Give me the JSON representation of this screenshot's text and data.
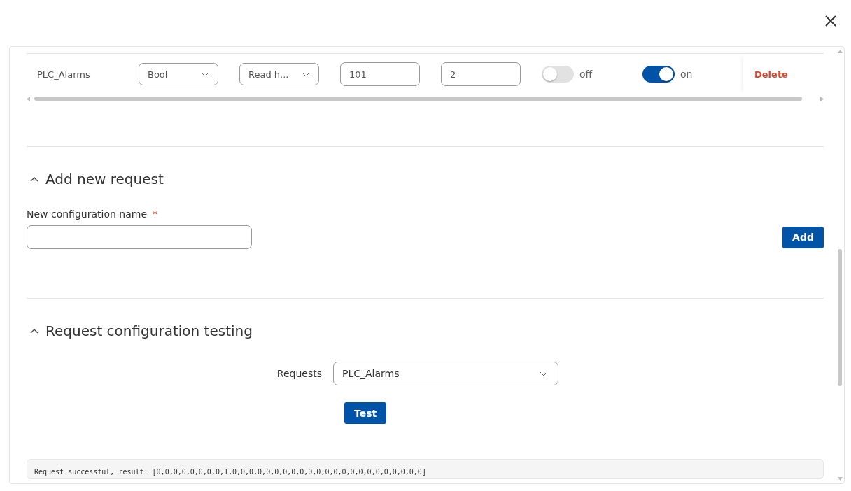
{
  "table": {
    "rows": [
      {
        "name": "PLC_Alarms",
        "type": "Bool",
        "function": "Read h...",
        "start": "101",
        "count": "2",
        "switches": [
          {
            "on": false,
            "label": "off"
          },
          {
            "on": true,
            "label": "on"
          }
        ],
        "delete": "Delete"
      }
    ]
  },
  "add_section": {
    "title": "Add new request",
    "expanded": true,
    "field_label": "New configuration name",
    "required_mark": "*",
    "button": "Add"
  },
  "test_section": {
    "title": "Request configuration testing",
    "expanded": true,
    "requests_label": "Requests",
    "requests_value": "PLC_Alarms",
    "button": "Test",
    "result": "Request successful, result: [0,0,0,0,0,0,0,0,1,0,0,0,0,0,0,0,0,0,0,0,0,0,0,0,0,0,0,0,0,0,0,0]"
  }
}
